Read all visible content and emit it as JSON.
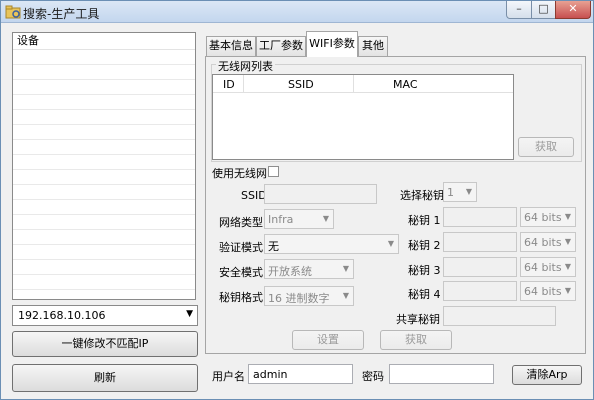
{
  "window": {
    "title": "搜索-生产工具",
    "min_label": "–",
    "max_label": "□",
    "close_label": "✕",
    "icon": "folder-icon"
  },
  "left_panel": {
    "device_list_header": "设备",
    "ip_selected": "192.168.10.106",
    "fix_button_label": "一键修改不匹配IP",
    "refresh_button_label": "刷新"
  },
  "tabs": [
    {
      "label": "基本信息"
    },
    {
      "label": "工厂参数"
    },
    {
      "label": "WIFI参数"
    },
    {
      "label": "其他"
    }
  ],
  "wifi": {
    "group_title": "无线网列表",
    "table_headers": [
      "ID",
      "SSID",
      "MAC"
    ],
    "fetch_list_button": "获取",
    "use_wifi_label": "使用无线网",
    "use_wifi_checked": false,
    "ssid_label": "SSID",
    "ssid_value": "",
    "network_type_label": "网络类型",
    "network_type_value": "Infra",
    "auth_mode_label": "验证模式",
    "auth_mode_value": "无",
    "security_mode_label": "安全模式",
    "security_mode_value": "开放系统",
    "key_format_label": "秘钥格式",
    "key_format_value": "16 进制数字",
    "select_key_label": "选择秘钥",
    "select_key_value": "1",
    "keys": [
      {
        "label": "秘钥 1",
        "value": "",
        "bits": "64 bits"
      },
      {
        "label": "秘钥 2",
        "value": "",
        "bits": "64 bits"
      },
      {
        "label": "秘钥 3",
        "value": "",
        "bits": "64 bits"
      },
      {
        "label": "秘钥 4",
        "value": "",
        "bits": "64 bits"
      }
    ],
    "shared_key_label": "共享秘钥",
    "shared_key_value": "",
    "set_button": "设置",
    "fetch_button": "获取"
  },
  "footer": {
    "username_label": "用户名",
    "username_value": "admin",
    "password_label": "密码",
    "password_value": "",
    "clear_arp_button": "清除Arp"
  }
}
